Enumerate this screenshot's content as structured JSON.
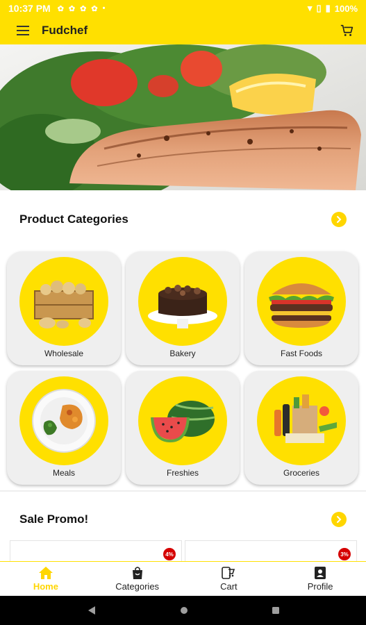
{
  "status_bar": {
    "time": "10:37 PM",
    "battery": "100%"
  },
  "app_bar": {
    "title": "Fudchef",
    "menu_icon": "hamburger-menu-icon",
    "cart_icon": "cart-icon"
  },
  "categories_section": {
    "title": "Product Categories",
    "items": [
      {
        "label": "Wholesale",
        "icon": "potato-crate-icon"
      },
      {
        "label": "Bakery",
        "icon": "cake-icon"
      },
      {
        "label": "Fast Foods",
        "icon": "burger-icon"
      },
      {
        "label": "Meals",
        "icon": "meal-plate-icon"
      },
      {
        "label": "Freshies",
        "icon": "watermelon-icon"
      },
      {
        "label": "Groceries",
        "icon": "grocery-bag-icon"
      }
    ]
  },
  "promo_section": {
    "title": "Sale Promo!",
    "items": [
      {
        "badge": "4%"
      },
      {
        "badge": "3%"
      }
    ]
  },
  "bottom_nav": [
    {
      "label": "Home",
      "active": true
    },
    {
      "label": "Categories",
      "active": false
    },
    {
      "label": "Cart",
      "active": false
    },
    {
      "label": "Profile",
      "active": false
    }
  ],
  "colors": {
    "accent": "#FFE000",
    "badge": "#D50000",
    "card_bg": "#EFEFEF"
  }
}
